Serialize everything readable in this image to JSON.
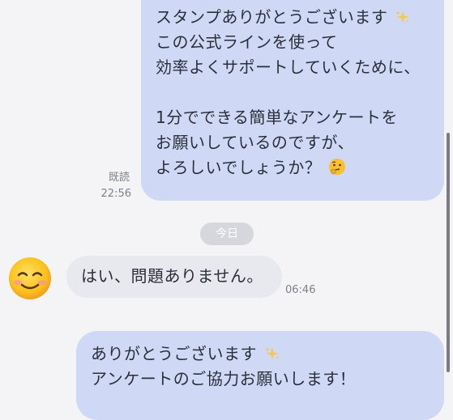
{
  "messages": [
    {
      "lines": [
        "スタンプありがとうございます",
        "この公式ラインを使って",
        "効率よくサポートしていくために、",
        "",
        "1分でできる簡単なアンケートを",
        "お願いしているのですが、",
        "よろしいでしょうか？"
      ],
      "read_label": "既読",
      "time": "22:56",
      "emojis": [
        "sparkles-icon",
        "thinking-face-icon"
      ]
    },
    {
      "text": "はい、問題ありません。",
      "time": "06:46",
      "avatar": "smiling-face-icon"
    },
    {
      "lines": [
        "ありがとうございます",
        "アンケートのご協力お願いします！"
      ],
      "emojis": [
        "sparkles-icon"
      ]
    }
  ],
  "date_chip": "今日",
  "colors": {
    "background": "#f4f4f6",
    "outgoing_bubble": "#cfd9f5",
    "incoming_bubble": "#e8e9ee",
    "date_chip": "#d6d7dc",
    "meta_text": "#7d808a"
  }
}
